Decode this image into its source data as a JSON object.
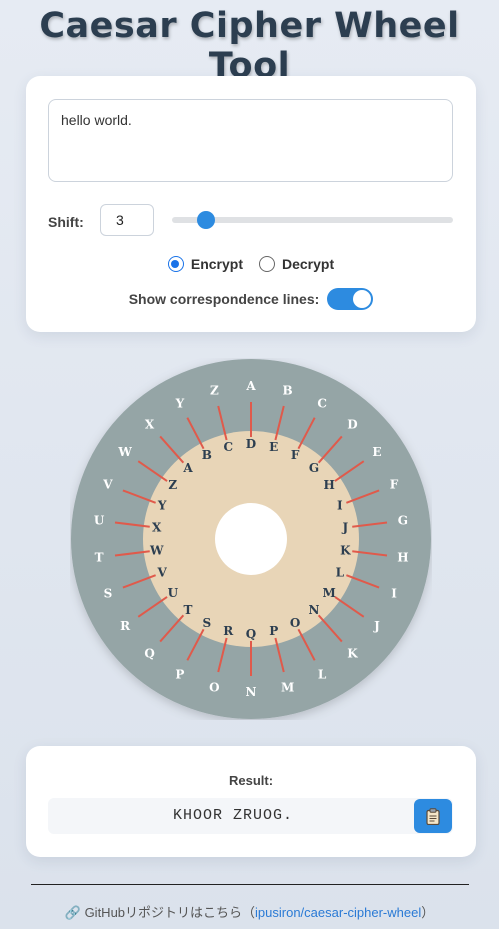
{
  "page": {
    "title": "Caesar Cipher Wheel Tool"
  },
  "input": {
    "text": "hello world."
  },
  "shift": {
    "label": "Shift:",
    "value": "3",
    "slider_fraction": 0.12
  },
  "mode": {
    "encrypt_label": "Encrypt",
    "decrypt_label": "Decrypt",
    "selected": "Encrypt"
  },
  "lines_toggle": {
    "label": "Show correspondence lines:",
    "on": true
  },
  "wheel": {
    "outer_letters": [
      "A",
      "B",
      "C",
      "D",
      "E",
      "F",
      "G",
      "H",
      "I",
      "J",
      "K",
      "L",
      "M",
      "N",
      "O",
      "P",
      "Q",
      "R",
      "S",
      "T",
      "U",
      "V",
      "W",
      "X",
      "Y",
      "Z"
    ],
    "inner_letters": [
      "D",
      "E",
      "F",
      "G",
      "H",
      "I",
      "J",
      "K",
      "L",
      "M",
      "N",
      "O",
      "P",
      "Q",
      "R",
      "S",
      "T",
      "U",
      "V",
      "W",
      "X",
      "Y",
      "Z",
      "A",
      "B",
      "C"
    ],
    "colors": {
      "outer_ring": "#95a5a6",
      "inner_ring": "#e8d5b7",
      "center": "#ffffff",
      "line": "#e05a4b",
      "outer_text": "#ffffff",
      "inner_text": "#2c3e50"
    }
  },
  "result": {
    "label": "Result:",
    "text": "KHOOR ZRUOG.",
    "copy_icon": "clipboard-icon"
  },
  "footer": {
    "icon": "link-icon",
    "prefix": "GitHubリポジトリはこちら（",
    "link_text": "ipusiron/caesar-cipher-wheel",
    "suffix": "）"
  },
  "colors": {
    "accent": "#2d8be0",
    "title": "#2c3e50"
  }
}
